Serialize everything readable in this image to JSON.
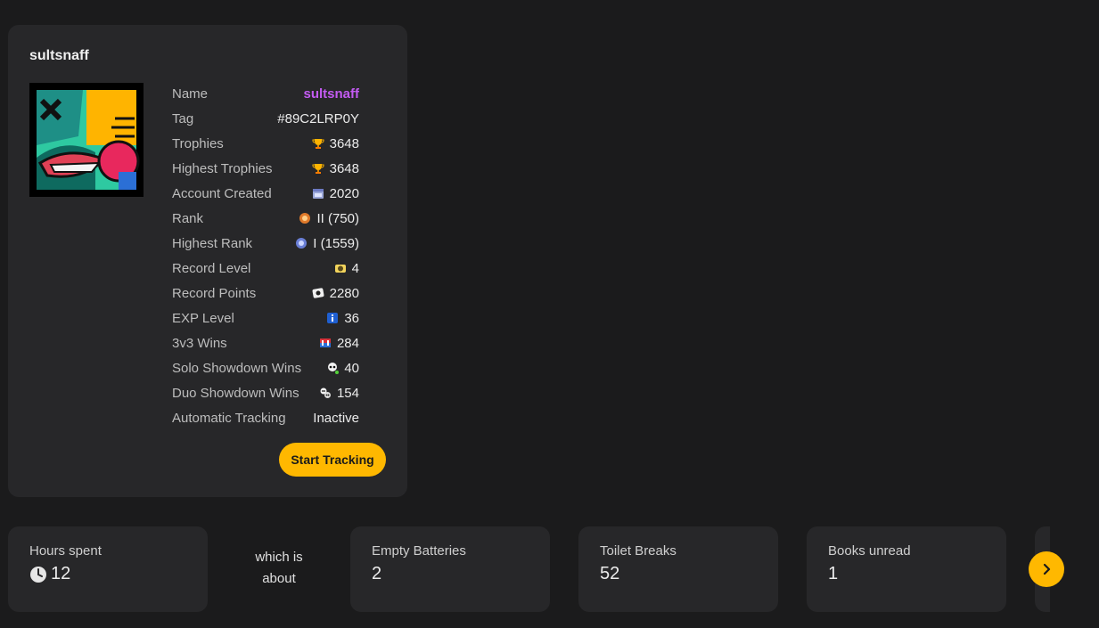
{
  "profile": {
    "username": "sultsnaff",
    "stats": [
      {
        "label": "Name",
        "value": "sultsnaff",
        "icon": "",
        "style": "purple"
      },
      {
        "label": "Tag",
        "value": "#89C2LRP0Y",
        "icon": ""
      },
      {
        "label": "Trophies",
        "value": "3648",
        "icon": "trophy-icon"
      },
      {
        "label": "Highest Trophies",
        "value": "3648",
        "icon": "trophy-icon"
      },
      {
        "label": "Account Created",
        "value": "2020",
        "icon": "calendar-icon"
      },
      {
        "label": "Rank",
        "value": "II (750)",
        "icon": "rank-badge-icon"
      },
      {
        "label": "Highest Rank",
        "value": "I (1559)",
        "icon": "highest-rank-badge-icon"
      },
      {
        "label": "Record Level",
        "value": "4",
        "icon": "record-level-icon"
      },
      {
        "label": "Record Points",
        "value": "2280",
        "icon": "record-points-icon"
      },
      {
        "label": "EXP Level",
        "value": "36",
        "icon": "info-icon"
      },
      {
        "label": "3v3 Wins",
        "value": "284",
        "icon": "3v3-icon"
      },
      {
        "label": "Solo Showdown Wins",
        "value": "40",
        "icon": "skull-icon"
      },
      {
        "label": "Duo Showdown Wins",
        "value": "154",
        "icon": "duo-skull-icon"
      },
      {
        "label": "Automatic Tracking",
        "value": "Inactive",
        "icon": ""
      }
    ],
    "start_tracking_label": "Start Tracking"
  },
  "summary": {
    "hours": {
      "title": "Hours spent",
      "value": "12",
      "icon": "clock-icon"
    },
    "which_is": "which is",
    "about": "about",
    "cards": [
      {
        "title": "Empty Batteries",
        "value": "2"
      },
      {
        "title": "Toilet Breaks",
        "value": "52"
      },
      {
        "title": "Books unread",
        "value": "1"
      }
    ]
  },
  "colors": {
    "accent": "#ffb800",
    "name_purple": "#c35bf2",
    "card_bg": "#272729",
    "page_bg": "#1b1b1c"
  }
}
